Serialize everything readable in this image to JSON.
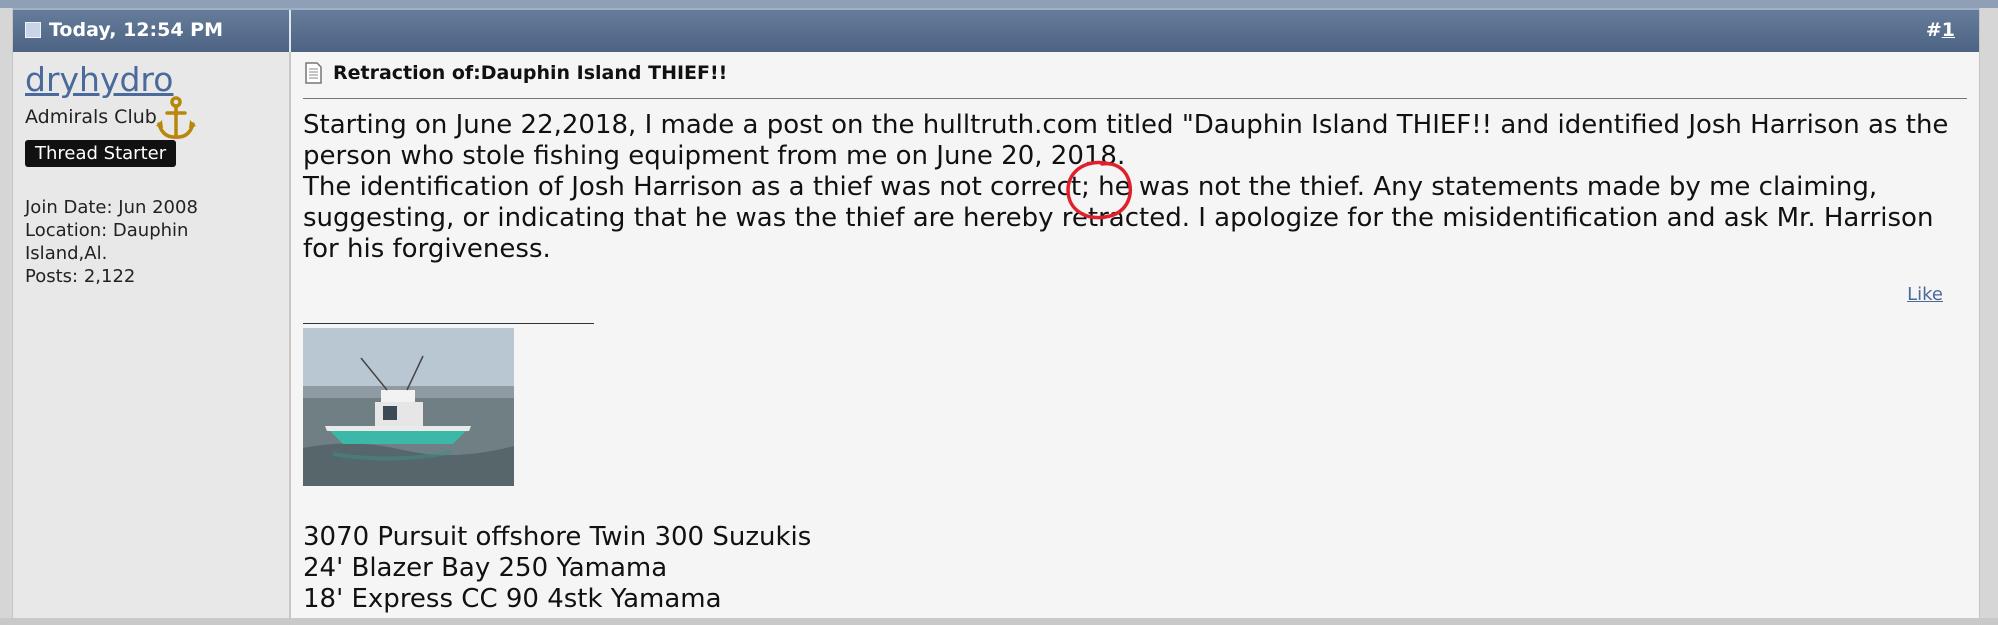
{
  "header": {
    "date": "Today, 12:54 PM",
    "post_hash": "#",
    "post_number": "1"
  },
  "user": {
    "username": "dryhydro",
    "title": "Admirals Club",
    "badge": "Thread Starter",
    "join_date": "Join Date: Jun 2008",
    "location_line1": "Location: Dauphin",
    "location_line2": "Island,Al.",
    "posts": "Posts: 2,122"
  },
  "post": {
    "title": "Retraction of:Dauphin Island THIEF!!",
    "paragraph1": "Starting on June 22,2018, I made a post on the hulltruth.com titled \"Dauphin Island THIEF!! and identified Josh Harrison as the person who stole fishing equipment from me on June 20, 2018.",
    "paragraph2": "The identification of Josh Harrison as a thief was not correct; he was not the thief. Any statements made by me claiming, suggesting, or indicating that he was the thief are hereby retracted. I apologize for the misidentification and ask Mr. Harrison for his forgiveness.",
    "like_label": "Like"
  },
  "signature": {
    "lines": [
      "3070 Pursuit offshore Twin 300 Suzukis",
      "24' Blazer Bay 250 Yamama",
      "18' Express CC 90 4stk Yamama"
    ]
  },
  "colors": {
    "header_bg": "#4c6384",
    "username_link": "#4a6a9b",
    "annotation_circle": "#e0202a"
  },
  "icons": {
    "header": "post-doc-icon",
    "title": "post-page-icon",
    "rank": "anchor-icon"
  }
}
